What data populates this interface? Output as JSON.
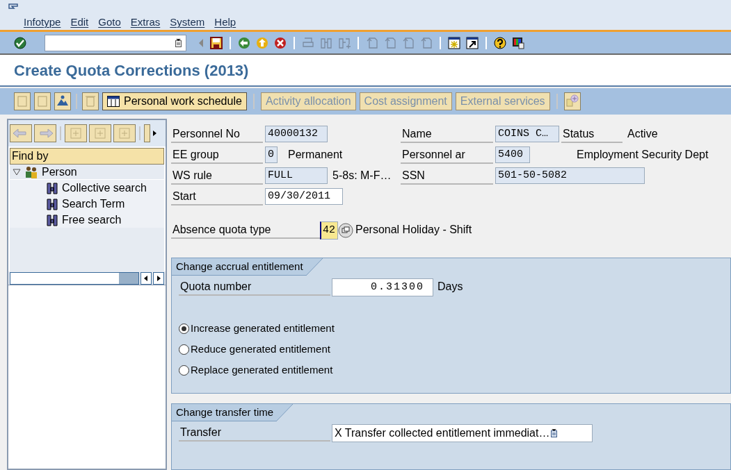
{
  "menu": [
    {
      "label": "Infotype"
    },
    {
      "label": "Edit"
    },
    {
      "label": "Goto"
    },
    {
      "label": "Extras"
    },
    {
      "label": "System"
    },
    {
      "label": "Help"
    }
  ],
  "title": "Create Quota Corrections (2013)",
  "app_toolbar": [
    {
      "label": "Personal work schedule",
      "disabled": false
    },
    {
      "label": "Activity allocation",
      "disabled": true
    },
    {
      "label": "Cost assignment",
      "disabled": true
    },
    {
      "label": "External services",
      "disabled": true
    }
  ],
  "navigator": {
    "header": "Find by",
    "tree": [
      {
        "label": "Person",
        "expanded": true,
        "children": [
          {
            "label": "Collective search"
          },
          {
            "label": "Search Term"
          },
          {
            "label": "Free search"
          }
        ]
      }
    ]
  },
  "header": {
    "personnel_no": {
      "label": "Personnel No",
      "value": "40000132"
    },
    "name": {
      "label": "Name",
      "value": "COINS C…"
    },
    "status": {
      "label": "Status",
      "value": "Active"
    },
    "ee_group": {
      "label": "EE group",
      "value": "0",
      "text": "Permanent"
    },
    "personnel_area": {
      "label": "Personnel ar",
      "value": "5400",
      "text": "Employment Security Dept"
    },
    "ws_rule": {
      "label": "WS rule",
      "value": "FULL",
      "text": "5-8s: M-F…"
    },
    "ssn": {
      "label": "SSN",
      "value": "501-50-5082"
    },
    "start": {
      "label": "Start",
      "value": "09/30/2011"
    }
  },
  "absence_quota": {
    "label": "Absence quota type",
    "value": "42",
    "text": "Personal Holiday - Shift"
  },
  "accrual": {
    "title": "Change accrual entitlement",
    "quota": {
      "label": "Quota number",
      "value": "0.31300",
      "unit": "Days"
    },
    "options": [
      {
        "label": "Increase generated entitlement",
        "selected": true
      },
      {
        "label": "Reduce generated entitlement",
        "selected": false
      },
      {
        "label": "Replace generated entitlement",
        "selected": false
      }
    ]
  },
  "transfer": {
    "title": "Change transfer time",
    "label": "Transfer",
    "value": "X Transfer collected entitlement immediat…"
  }
}
